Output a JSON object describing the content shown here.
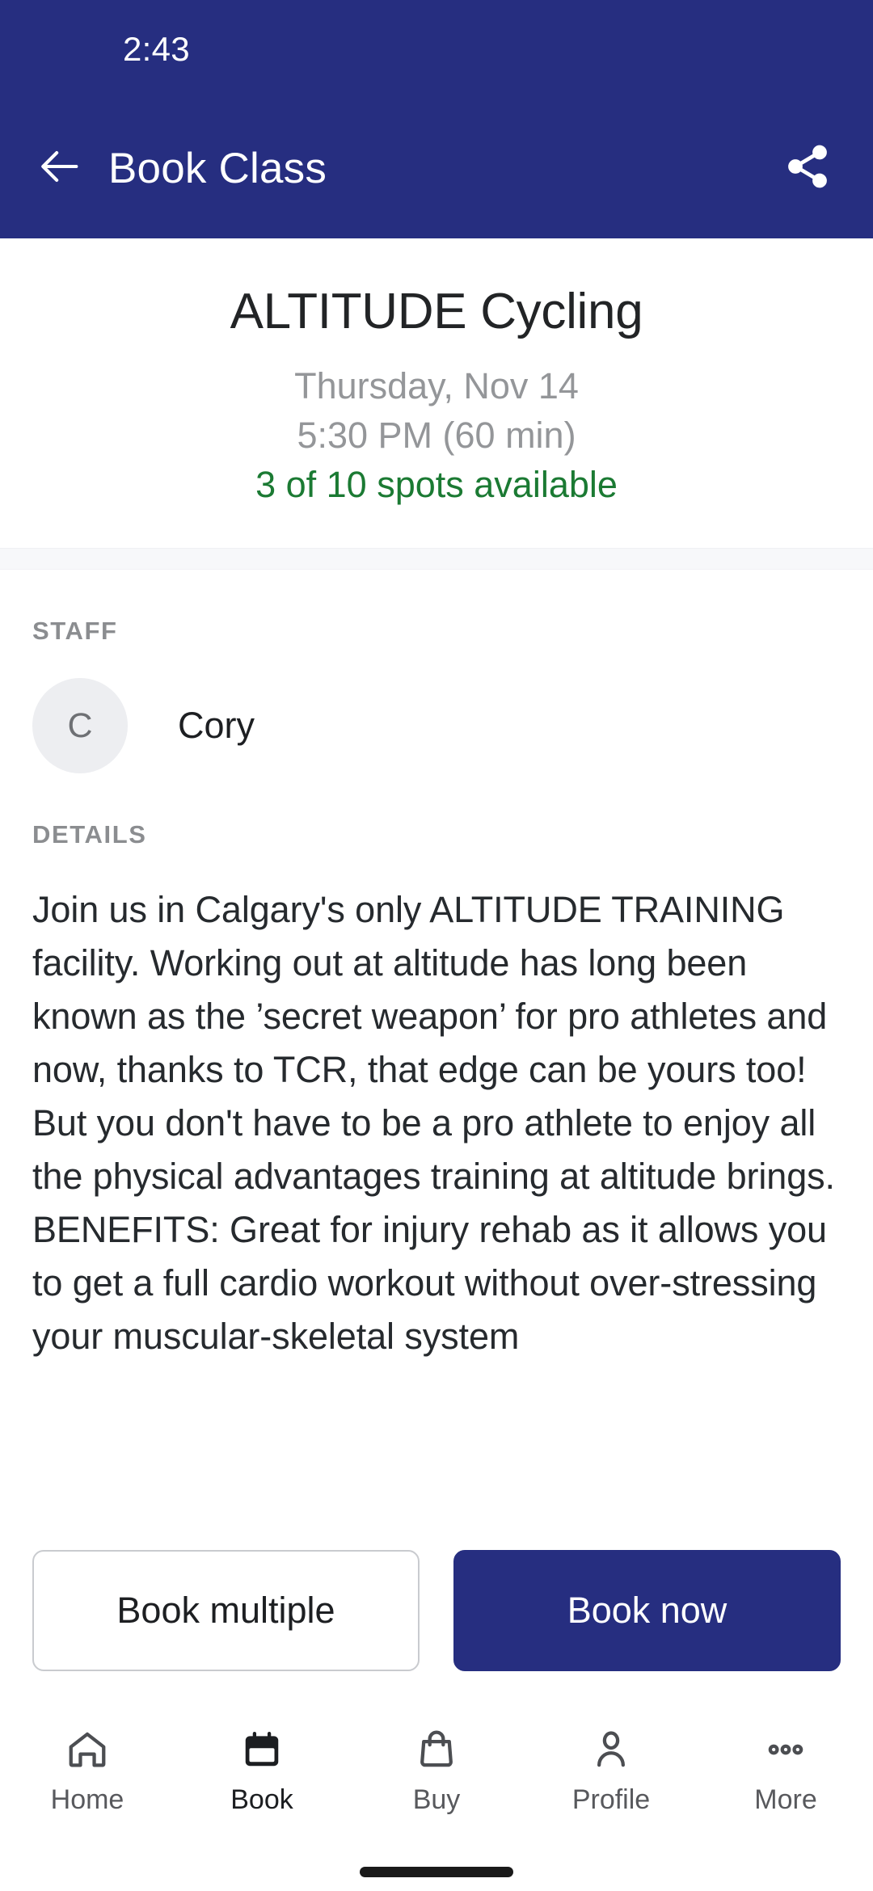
{
  "theme": {
    "primary": "#262E80",
    "success_green": "#1B7A33",
    "muted_gray": "#949699",
    "label_gray": "#8B8D90",
    "band_gray": "#F7F8FA",
    "body_text": "#262A2E"
  },
  "status_bar": {
    "time": "2:43"
  },
  "app_bar": {
    "title": "Book Class",
    "back_icon": "arrow-left-icon",
    "share_icon": "share-icon"
  },
  "class_header": {
    "title": "ALTITUDE Cycling",
    "date": "Thursday, Nov 14",
    "time": "5:30 PM (60 min)",
    "spots": "3 of 10 spots available"
  },
  "staff_section": {
    "label": "STAFF",
    "avatar_initial": "C",
    "name": "Cory"
  },
  "details_section": {
    "label": "DETAILS",
    "body": "Join us in Calgary's only ALTITUDE TRAINING facility. Working out at altitude has long been known as the ’secret weapon’ for pro athletes and now, thanks to TCR, that edge can be yours too! But you don't have to be a pro athlete to enjoy all the physical advantages training at altitude brings. BENEFITS: Great for injury rehab as it allows you to get a full cardio workout without over-stressing your muscular-skeletal system"
  },
  "actions": {
    "secondary_label": "Book multiple",
    "primary_label": "Book now"
  },
  "bottom_nav": {
    "items": [
      {
        "label": "Home",
        "icon": "home-icon",
        "active": false
      },
      {
        "label": "Book",
        "icon": "calendar-icon",
        "active": true
      },
      {
        "label": "Buy",
        "icon": "shopping-bag-icon",
        "active": false
      },
      {
        "label": "Profile",
        "icon": "person-icon",
        "active": false
      },
      {
        "label": "More",
        "icon": "ellipsis-icon",
        "active": false
      }
    ]
  }
}
